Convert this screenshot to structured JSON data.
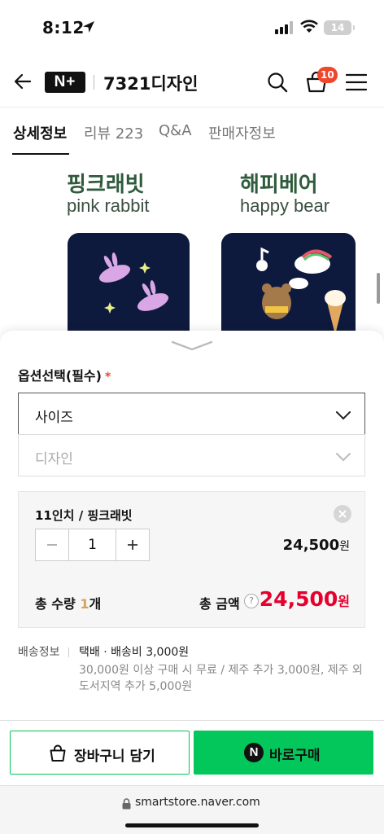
{
  "status_bar": {
    "time": "8:12",
    "battery": "14"
  },
  "header": {
    "brand_logo": "N+",
    "store_name": "7321디자인",
    "cart_count": "10"
  },
  "tabs": [
    {
      "label": "상세정보",
      "active": true
    },
    {
      "label": "리뷰 223",
      "active": false
    },
    {
      "label": "Q&A",
      "active": false
    },
    {
      "label": "판매자정보",
      "active": false
    }
  ],
  "product_images": [
    {
      "title": "핑크래빗",
      "subtitle": "pink rabbit"
    },
    {
      "title": "해피베어",
      "subtitle": "happy bear"
    }
  ],
  "options": {
    "label": "옵션선택(필수)",
    "required_mark": "*",
    "size_select": "사이즈",
    "design_select": "디자인"
  },
  "selected_item": {
    "name": "11인치 / 핑크래빗",
    "quantity": "1",
    "price": "24,500",
    "price_unit": "원"
  },
  "total": {
    "qty_label": "총 수량",
    "qty_value": "1",
    "qty_unit": "개",
    "amount_label": "총 금액",
    "help": "?",
    "amount": "24,500",
    "amount_unit": "원"
  },
  "shipping": {
    "label": "배송정보",
    "value": "택배 · 배송비 3,000원",
    "note": "30,000원 이상 구매 시 무료 / 제주 추가 3,000원, 제주 외 도서지역 추가 5,000원"
  },
  "actions": {
    "cart_button": "장바구니 담기",
    "buy_button": "바로구매",
    "buy_icon": "N"
  },
  "browser": {
    "url": "smartstore.naver.com"
  },
  "colors": {
    "accent_green": "#03c75a",
    "price_red": "#e5002d",
    "badge_orange": "#f0462c"
  }
}
